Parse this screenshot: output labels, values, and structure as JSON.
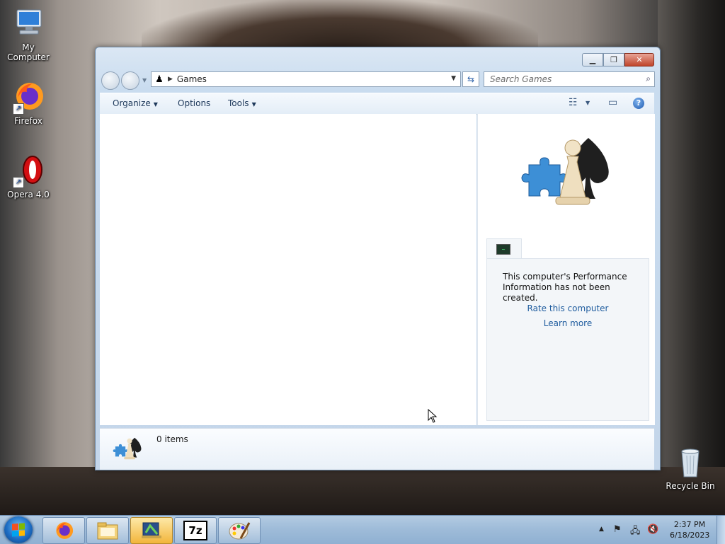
{
  "desktop": {
    "icons": [
      {
        "label": "My Computer",
        "icon": "computer-icon"
      },
      {
        "label": "Firefox",
        "icon": "firefox-icon"
      },
      {
        "label": "Opera 4.0",
        "icon": "opera-icon"
      },
      {
        "label": "Recycle Bin",
        "icon": "recycle-bin-icon"
      }
    ]
  },
  "window": {
    "breadcrumb": "Games",
    "search_placeholder": "Search Games",
    "toolbar": {
      "organize": "Organize",
      "options": "Options",
      "tools": "Tools"
    },
    "preview_pane": {
      "perf_message": "This computer's Performance Information has not been created.",
      "rate_link": "Rate this computer",
      "learn_link": "Learn more"
    },
    "details": {
      "count": "0 items"
    }
  },
  "taskbar": {
    "pinned": [
      "firefox-icon",
      "explorer-icon",
      "games-icon",
      "7zip-icon",
      "paint-icon"
    ],
    "sevenzip_label": "7z",
    "clock_time": "2:37 PM",
    "clock_date": "6/18/2023"
  },
  "colors": {
    "link": "#1f5c9e",
    "toolbar_text": "#1e395b",
    "active_task": "#f2b53b"
  }
}
